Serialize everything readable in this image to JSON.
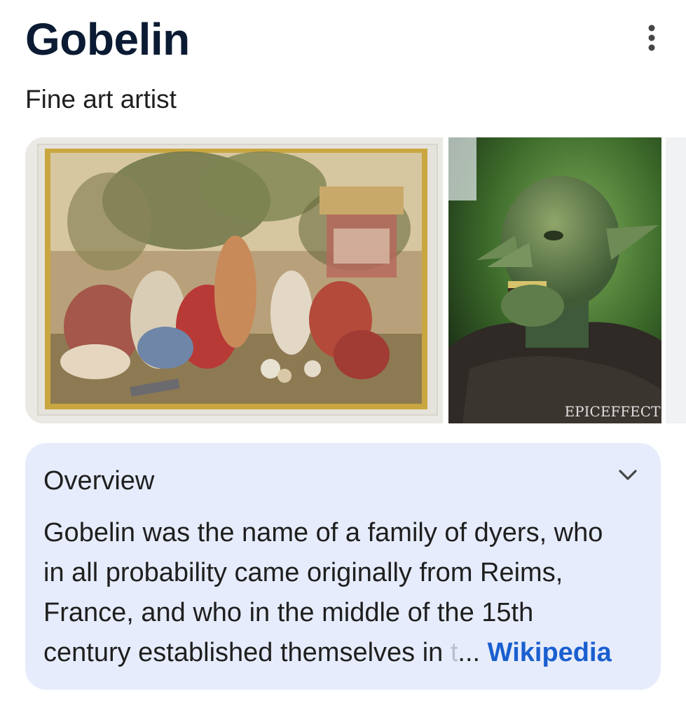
{
  "entity": {
    "title": "Gobelin",
    "subtitle": "Fine art artist"
  },
  "icons": {
    "more": "more-vert-icon",
    "expand": "chevron-down-icon"
  },
  "images": [
    {
      "name": "tapestry-image"
    },
    {
      "name": "goblin-mask-image",
      "watermark": "EPICEFFECT"
    },
    {
      "name": "third-image-partial"
    }
  ],
  "overview": {
    "heading": "Overview",
    "lines": [
      "Gobelin was the name of a family of dyers, who",
      "in all probability came originally from Reims,",
      "France, and who in the middle of the 15th",
      "century established themselves in "
    ],
    "faded_char": "t",
    "ellipsis": "...",
    "source": "Wikipedia"
  },
  "colors": {
    "title": "#0b1b33",
    "overview_bg": "#e6ecfb",
    "link": "#1a5fcf"
  }
}
